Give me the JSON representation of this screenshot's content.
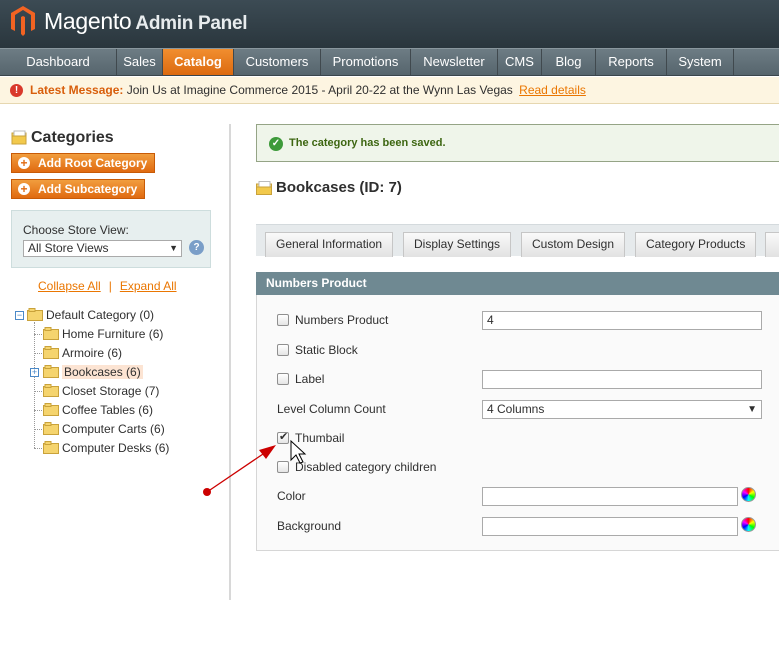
{
  "header": {
    "logo_text": "Magento",
    "logo_subtitle": "Admin Panel",
    "logo_icon": "magento-logo-icon"
  },
  "nav": {
    "items": [
      "Dashboard",
      "Sales",
      "Catalog",
      "Customers",
      "Promotions",
      "Newsletter",
      "CMS",
      "Blog",
      "Reports",
      "System"
    ],
    "active": "Catalog"
  },
  "message": {
    "icon": "alert-icon",
    "title": "Latest Message:",
    "text": "Join Us at Imagine Commerce 2015 - April 20-22 at the Wynn Las Vegas",
    "link": "Read details"
  },
  "sidebar": {
    "title": "Categories",
    "add_root_button": "Add Root Category",
    "add_sub_button": "Add Subcategory",
    "store_view_label": "Choose Store View:",
    "store_view_value": "All Store Views",
    "collapse_all": "Collapse All",
    "expand_all": "Expand All",
    "separator": "|",
    "tree": {
      "root": "Default Category (0)",
      "children": [
        "Home Furniture (6)",
        "Armoire (6)",
        "Bookcases (6)",
        "Closet Storage (7)",
        "Coffee Tables (6)",
        "Computer Carts (6)",
        "Computer Desks (6)"
      ],
      "selected": "Bookcases (6)"
    }
  },
  "main": {
    "success_message": "The category has been saved.",
    "page_title": "Bookcases (ID: 7)",
    "tabs": [
      "General Information",
      "Display Settings",
      "Custom Design",
      "Category Products"
    ],
    "fieldset_title": "Numbers Product",
    "fields": {
      "numbers_product": {
        "label": "Numbers Product",
        "value": "4",
        "checked": false
      },
      "static_block": {
        "label": "Static Block",
        "checked": false
      },
      "label": {
        "label": "Label",
        "value": "",
        "checked": false
      },
      "level_column_count": {
        "label": "Level Column Count",
        "value": "4 Columns"
      },
      "thumbail": {
        "label": "Thumbail",
        "checked": true
      },
      "disabled_children": {
        "label": "Disabled category children",
        "checked": false
      },
      "color": {
        "label": "Color",
        "value": ""
      },
      "background": {
        "label": "Background",
        "value": ""
      }
    }
  },
  "colors": {
    "accent": "#eb7b1e",
    "header_bg": "#2f3b42",
    "annotation": "#cc0000"
  }
}
